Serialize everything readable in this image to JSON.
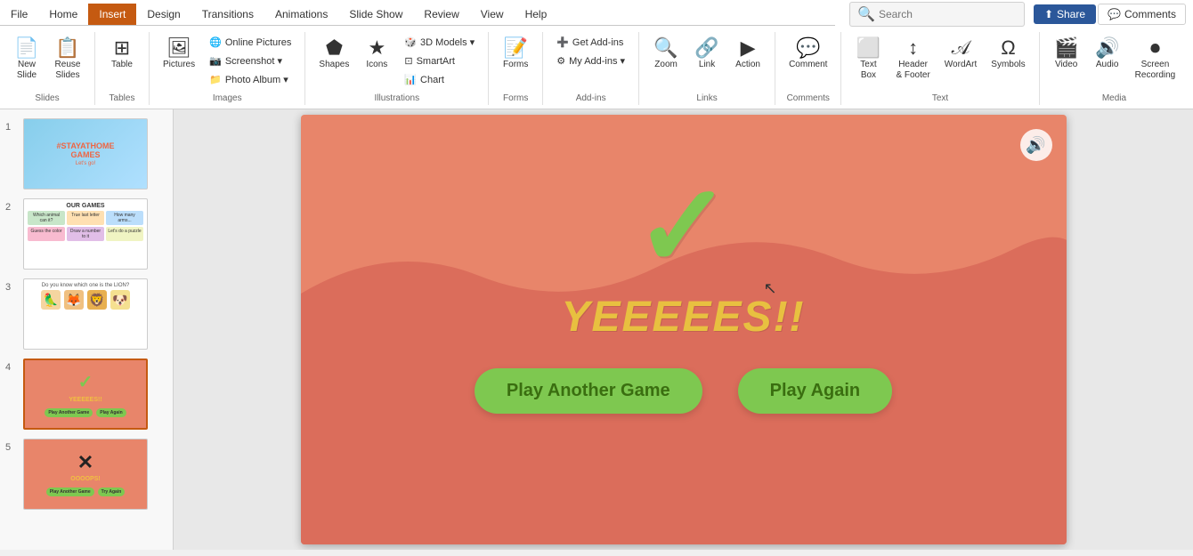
{
  "ribbon": {
    "tabs": [
      "File",
      "Home",
      "Insert",
      "Design",
      "Transitions",
      "Animations",
      "Slide Show",
      "Review",
      "View",
      "Help"
    ],
    "active_tab": "Insert",
    "search_placeholder": "Search",
    "share_label": "Share",
    "comments_label": "Comments",
    "groups": {
      "slides": {
        "label": "Slides",
        "buttons": [
          "New Slide",
          "Reuse Slides"
        ]
      },
      "tables": {
        "label": "Tables",
        "buttons": [
          "Table"
        ]
      },
      "images": {
        "label": "Images",
        "buttons": [
          "Pictures",
          "Online Pictures",
          "Screenshot",
          "Photo Album"
        ]
      },
      "illustrations": {
        "label": "Illustrations",
        "buttons": [
          "Shapes",
          "Icons",
          "3D Models",
          "SmartArt",
          "Chart"
        ]
      },
      "forms": {
        "label": "Forms",
        "buttons": [
          "Forms"
        ]
      },
      "addins": {
        "label": "Add-ins",
        "buttons": [
          "Get Add-ins",
          "My Add-ins"
        ]
      },
      "links": {
        "label": "Links",
        "buttons": [
          "Zoom",
          "Link",
          "Action"
        ]
      },
      "comments": {
        "label": "Comments",
        "buttons": [
          "Comment"
        ]
      },
      "text": {
        "label": "Text",
        "buttons": [
          "Text Box",
          "Header & Footer",
          "WordArt",
          "Symbols"
        ]
      },
      "media": {
        "label": "Media",
        "buttons": [
          "Video",
          "Audio",
          "Screen Recording"
        ]
      }
    }
  },
  "slides": [
    {
      "num": "1",
      "label": "Slide 1 - Stay at Home Games"
    },
    {
      "num": "2",
      "label": "Slide 2 - Our Games"
    },
    {
      "num": "3",
      "label": "Slide 3 - Lion Question"
    },
    {
      "num": "4",
      "label": "Slide 4 - Correct Answer",
      "active": true
    },
    {
      "num": "5",
      "label": "Slide 5 - Wrong Answer"
    }
  ],
  "canvas": {
    "checkmark": "✓",
    "yes_text": "YEEEEES!!",
    "btn_play_another": "Play Another Game",
    "btn_play_again": "Play Again"
  }
}
